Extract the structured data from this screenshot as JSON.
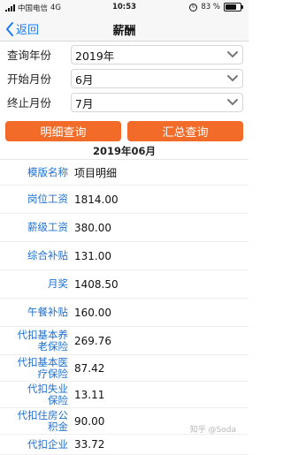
{
  "status_bar": {
    "carrier": "中国电信",
    "network": "4G",
    "time": "10:53",
    "battery_percent": "83 %",
    "battery_level": 0.83
  },
  "nav": {
    "back_label": "返回",
    "title": "薪酬"
  },
  "form": {
    "year_label": "查询年份",
    "year_value": "2019年",
    "start_month_label": "开始月份",
    "start_month_value": "6月",
    "end_month_label": "终止月份",
    "end_month_value": "7月"
  },
  "buttons": {
    "detail_query": "明细查询",
    "summary_query": "汇总查询"
  },
  "period": "2019年06月",
  "details": [
    {
      "key": "模版名称",
      "value": "项目明细"
    },
    {
      "key": "岗位工资",
      "value": "1814.00"
    },
    {
      "key": "薪级工资",
      "value": "380.00"
    },
    {
      "key": "综合补贴",
      "value": "131.00"
    },
    {
      "key": "月奖",
      "value": "1408.50"
    },
    {
      "key": "午餐补贴",
      "value": "160.00"
    },
    {
      "key": "代扣基本养老保险",
      "value": "269.76"
    },
    {
      "key": "代扣基本医疗保险",
      "value": "87.42"
    },
    {
      "key": "代扣失业保险",
      "value": "13.11"
    },
    {
      "key": "代扣住房公积金",
      "value": "90.00"
    },
    {
      "key": "代扣企业",
      "value": "33.72"
    }
  ],
  "watermark": "知乎 @Soda",
  "colors": {
    "accent_orange": "#f26b28",
    "label_blue": "#1d6fd0",
    "link_blue": "#1a7cf5"
  }
}
